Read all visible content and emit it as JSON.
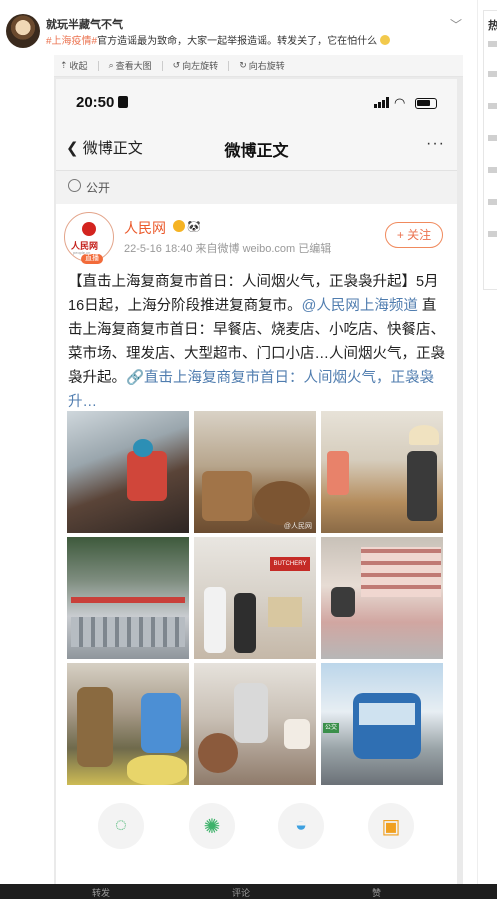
{
  "post": {
    "username": "就玩半藏气不气",
    "tag1": "#上海疫情#",
    "text": "官方造谣最为致命，大家一起举报造谣。转发关了，它在怕什么"
  },
  "sidebar": {
    "heading_char": "热"
  },
  "viewer": {
    "toolbar": [
      "收起",
      "查看大图",
      "向左旋转",
      "向右旋转"
    ]
  },
  "phone": {
    "time": "20:50",
    "back_label": "微博正文",
    "title": "微博正文",
    "more": "···",
    "visibility": "公开",
    "author": {
      "name": "人民网",
      "avatar_text": "人民网",
      "avatar_url_text": "people.cn",
      "live_badge": "直播",
      "meta": "22-5-16 18:40  来自微博 weibo.com  已编辑",
      "follow_label": "+ 关注"
    },
    "body_part1": "【直击上海复商复市首日：人间烟火气，正袅袅升起】5月16日起，上海分阶段推进复商复市。",
    "mention": "@人民网上海频道",
    "body_part2": " 直击上海复商复市首日：早餐店、烧麦店、小吃店、快餐店、菜市场、理发店、大型超市、门口小店…人间烟火气，正袅袅升起。",
    "link_text": "🔗直击上海复商复市首日：人间烟火气，正袅袅升…",
    "photo_watermark": "@人民网",
    "photo_sign": "BUTCHERY",
    "bus_sign": "公交"
  },
  "colors": {
    "accent": "#eb7350",
    "link": "#507daf",
    "tag": "#eb7350"
  },
  "icons": [
    "wechat-icon",
    "moments-icon",
    "qq-icon",
    "save-image-icon"
  ],
  "bottom": {
    "labels": [
      "转发",
      "评论",
      "赞"
    ]
  }
}
